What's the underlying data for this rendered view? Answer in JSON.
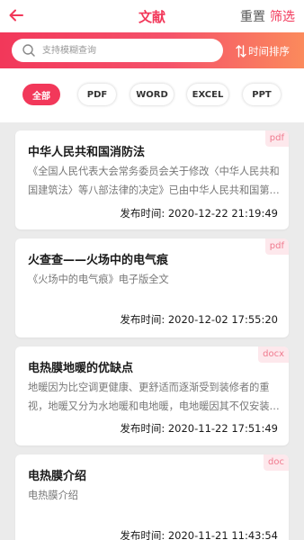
{
  "header": {
    "title": "文献",
    "reset_label": "重置",
    "filter_label": "筛选"
  },
  "search": {
    "placeholder": "支持模糊查询",
    "sort_label": "时间排序"
  },
  "filters": [
    {
      "label": "全部",
      "active": true
    },
    {
      "label": "PDF",
      "active": false
    },
    {
      "label": "WORD",
      "active": false
    },
    {
      "label": "EXCEL",
      "active": false
    },
    {
      "label": "PPT",
      "active": false
    }
  ],
  "documents": [
    {
      "title": "中华人民共和国消防法",
      "description": "《全国人民代表大会常务委员会关于修改〈中华人民共和国建筑法〉等八部法律的决定》已由中华人民共和国第十三届全国人民代表大会常务委员会第十次会议通过",
      "time": "发布时间: 2020-12-22 21:19:49",
      "type": "pdf"
    },
    {
      "title": "火查查——火场中的电气痕",
      "description": "《火场中的电气痕》电子版全文",
      "time": "发布时间: 2020-12-02 17:55:20",
      "type": "pdf"
    },
    {
      "title": "电热膜地暖的优缺点",
      "description": "地暖因为比空调更健康、更舒适而逐渐受到装修者的重视，地暖又分为水地暖和电地暖，电地暖因其不仅安装方便而且使用寿命长",
      "time": "发布时间: 2020-11-22 17:51:49",
      "type": "docx"
    },
    {
      "title": "电热膜介绍",
      "description": "电热膜介绍",
      "time": "发布时间: 2020-11-21 11:43:54",
      "type": "doc"
    }
  ],
  "colors": {
    "accent": "#f2385a",
    "gradient_end": "#fb8a5c",
    "tag_background": "#fde8ec",
    "tag_text": "#f07a8e",
    "page_background": "#ebebeb"
  },
  "icons": {
    "back": "arrow-left-icon",
    "search": "search-icon",
    "sort": "sort-arrows-icon"
  }
}
